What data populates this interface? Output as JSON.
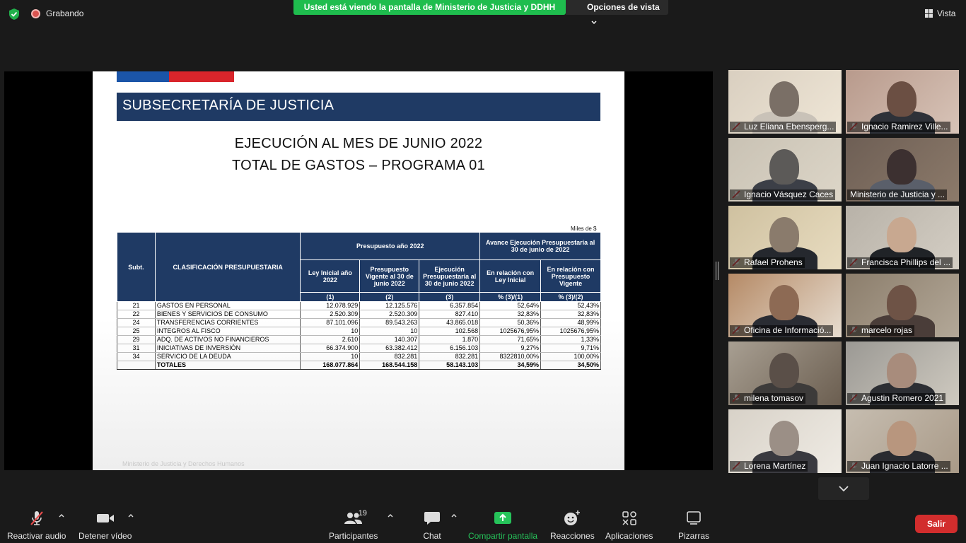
{
  "topbar": {
    "recording_label": "Grabando",
    "share_banner": "Usted está viendo la pantalla de Ministerio de Justicia y DDHH",
    "view_options_label": "Opciones de vista",
    "vista_label": "Vista"
  },
  "slide": {
    "header": "SUBSECRETARÍA DE JUSTICIA",
    "title_line1": "EJECUCIÓN AL MES DE JUNIO 2022",
    "title_line2": "TOTAL DE GASTOS – PROGRAMA 01",
    "units_note": "Miles de $",
    "footer": "Ministerio de Justicia y Derechos Humanos",
    "table": {
      "h_subt": "Subt.",
      "h_clasif": "CLASIFICACIÓN PRESUPUESTARIA",
      "h_presupuesto": "Presupuesto año 2022",
      "h_avance": "Avance Ejecución Presupuestaria al 30 de junio de 2022",
      "h_ley_inicial": "Ley Inicial año 2022",
      "h_vigente": "Presupuesto Vigente al 30 de junio 2022",
      "h_ejecucion": "Ejecución Presupuestaria al 30 de junio 2022",
      "h_rel_ley": "En relación con Ley Inicial",
      "h_rel_vigente": "En relación con Presupuesto Vigente",
      "n1": "(1)",
      "n2": "(2)",
      "n3": "(3)",
      "n31": "% (3)/(1)",
      "n32": "% (3)/(2)",
      "rows": [
        {
          "subt": "21",
          "clasif": "GASTOS EN PERSONAL",
          "ley": "12.078.929",
          "vig": "12.125.576",
          "ejec": "6.357.854",
          "p1": "52,64%",
          "p2": "52,43%"
        },
        {
          "subt": "22",
          "clasif": "BIENES Y SERVICIOS DE CONSUMO",
          "ley": "2.520.309",
          "vig": "2.520.309",
          "ejec": "827.410",
          "p1": "32,83%",
          "p2": "32,83%"
        },
        {
          "subt": "24",
          "clasif": "TRANSFERENCIAS CORRIENTES",
          "ley": "87.101.096",
          "vig": "89.543.263",
          "ejec": "43.865.018",
          "p1": "50,36%",
          "p2": "48,99%"
        },
        {
          "subt": "25",
          "clasif": "INTEGROS AL FISCO",
          "ley": "10",
          "vig": "10",
          "ejec": "102.568",
          "p1": "1025676,95%",
          "p2": "1025676,95%"
        },
        {
          "subt": "29",
          "clasif": "ADQ. DE ACTIVOS NO FINANCIEROS",
          "ley": "2.610",
          "vig": "140.307",
          "ejec": "1.870",
          "p1": "71,65%",
          "p2": "1,33%"
        },
        {
          "subt": "31",
          "clasif": "INICIATIVAS DE INVERSIÓN",
          "ley": "66.374.900",
          "vig": "63.382.412",
          "ejec": "6.156.103",
          "p1": "9,27%",
          "p2": "9,71%"
        },
        {
          "subt": "34",
          "clasif": "SERVICIO DE LA DEUDA",
          "ley": "10",
          "vig": "832.281",
          "ejec": "832.281",
          "p1": "8322810,00%",
          "p2": "100,00%"
        }
      ],
      "total": {
        "subt": "",
        "clasif": "TOTALES",
        "ley": "168.077.864",
        "vig": "168.544.158",
        "ejec": "58.143.103",
        "p1": "34,59%",
        "p2": "34,50%"
      }
    }
  },
  "participants": [
    {
      "name": "Luz Eliana Ebensperg...",
      "muted": true
    },
    {
      "name": "Ignacio Ramirez Ville...",
      "muted": true
    },
    {
      "name": "Ignacio Vásquez Caces",
      "muted": true
    },
    {
      "name": "Ministerio de Justicia y ...",
      "muted": false,
      "active": true
    },
    {
      "name": "Rafael Prohens",
      "muted": true
    },
    {
      "name": "Francisca Phillips del ...",
      "muted": true
    },
    {
      "name": "Oficina de Informació...",
      "muted": true
    },
    {
      "name": "marcelo rojas",
      "muted": true
    },
    {
      "name": "milena tomasov",
      "muted": true
    },
    {
      "name": "Agustin Romero 2021",
      "muted": true
    },
    {
      "name": "Lorena Martínez",
      "muted": true
    },
    {
      "name": "Juan Ignacio Latorre ...",
      "muted": true
    }
  ],
  "toolbar": {
    "audio_label": "Reactivar audio",
    "video_label": "Detener vídeo",
    "participants_label": "Participantes",
    "participants_count": "19",
    "chat_label": "Chat",
    "share_label": "Compartir pantalla",
    "reactions_label": "Reacciones",
    "apps_label": "Aplicaciones",
    "whiteboards_label": "Pizarras",
    "leave_label": "Salir"
  },
  "colors": {
    "share_green": "#1fbd4e",
    "slide_navy": "#1f3a64",
    "leave_red": "#d22d2d",
    "active_speaker": "#e7d03c"
  }
}
